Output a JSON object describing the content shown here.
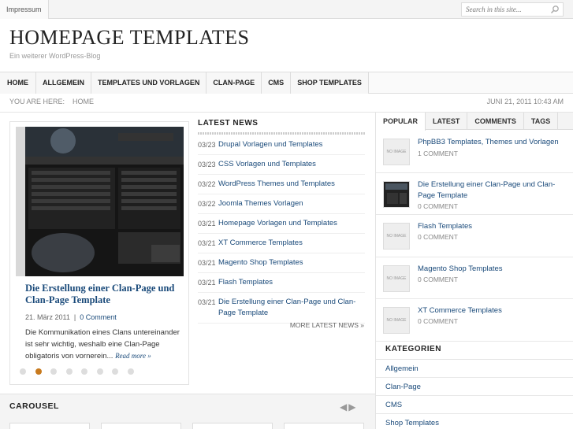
{
  "topbar": {
    "impressum": "Impressum",
    "search_placeholder": "Search in this site..."
  },
  "header": {
    "title": "HOMEPAGE TEMPLATES",
    "tagline": "Ein weiterer WordPress-Blog"
  },
  "nav": [
    "HOME",
    "ALLGEMEIN",
    "TEMPLATES UND VORLAGEN",
    "CLAN-PAGE",
    "CMS",
    "SHOP TEMPLATES"
  ],
  "breadcrumb": {
    "label": "YOU ARE HERE:",
    "home": "HOME",
    "date": "JUNI 21, 2011 10:43 AM"
  },
  "featured": {
    "title": "Die Erstellung einer Clan-Page und Clan-Page Template",
    "date": "21. März 2011",
    "comments": "0 Comment",
    "excerpt": "Die Kommunikation eines Clans untereinander ist sehr wichtig, weshalb eine Clan-Page obligatoris von vornerein...",
    "read_more": "Read more »",
    "slides": 8,
    "active_slide": 2
  },
  "latest_news": {
    "heading": "LATEST NEWS",
    "items": [
      {
        "date": "03/23",
        "title": "Drupal Vorlagen und Templates"
      },
      {
        "date": "03/23",
        "title": "CSS Vorlagen und Templates"
      },
      {
        "date": "03/22",
        "title": "WordPress Themes und Templates"
      },
      {
        "date": "03/22",
        "title": "Joomla Themes Vorlagen"
      },
      {
        "date": "03/21",
        "title": "Homepage Vorlagen und Templates"
      },
      {
        "date": "03/21",
        "title": "XT Commerce Templates"
      },
      {
        "date": "03/21",
        "title": "Magento Shop Templates"
      },
      {
        "date": "03/21",
        "title": "Flash Templates"
      },
      {
        "date": "03/21",
        "title": "Die Erstellung einer Clan-Page und Clan-Page Template"
      }
    ],
    "more": "MORE LATEST NEWS »"
  },
  "sidebar": {
    "tabs": [
      "POPULAR",
      "LATEST",
      "COMMENTS",
      "TAGS"
    ],
    "no_image": "NO IMAGE",
    "popular": [
      {
        "title": "PhpBB3 Templates, Themes und Vorlagen",
        "comments": "1 COMMENT",
        "has_image": false
      },
      {
        "title": "Die Erstellung einer Clan-Page und Clan-Page Template",
        "comments": "0 COMMENT",
        "has_image": true
      },
      {
        "title": "Flash Templates",
        "comments": "0 COMMENT",
        "has_image": false
      },
      {
        "title": "Magento Shop Templates",
        "comments": "0 COMMENT",
        "has_image": false
      },
      {
        "title": "XT Commerce Templates",
        "comments": "0 COMMENT",
        "has_image": false
      }
    ],
    "kategorien_heading": "KATEGORIEN",
    "kategorien": [
      "Allgemein",
      "Clan-Page",
      "CMS",
      "Shop Templates"
    ]
  },
  "carousel": {
    "heading": "CAROUSEL"
  }
}
